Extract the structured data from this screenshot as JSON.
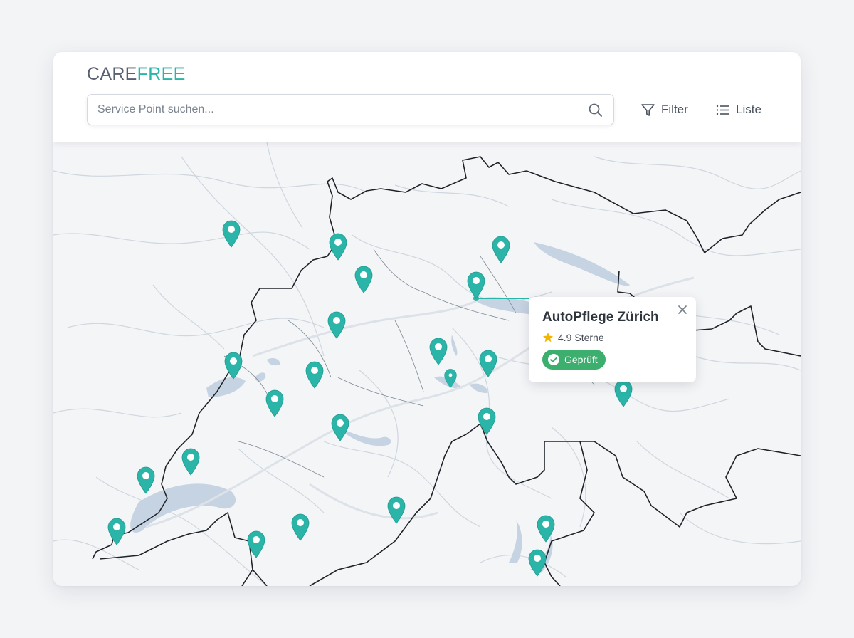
{
  "app": {
    "logo_part1": "CARE",
    "logo_part2": "FREE"
  },
  "search": {
    "placeholder": "Service Point suchen...",
    "value": "",
    "icon": "search-icon"
  },
  "toolbar": {
    "filter_label": "Filter",
    "filter_icon": "filter-icon",
    "list_label": "Liste",
    "list_icon": "list-icon"
  },
  "map": {
    "region": "Switzerland",
    "pin_color": "#2bb5a8",
    "pin_count": 23,
    "selected_pin": "AutoPflege Zürich"
  },
  "popup": {
    "title": "AutoPflege Zürich",
    "rating": "4.9 Sterne",
    "rating_icon": "star-icon",
    "badge": "Geprüft",
    "badge_icon": "check-circle-icon",
    "close_icon": "close-icon"
  },
  "colors": {
    "accent": "#2bb5a8",
    "logo_gray": "#586170",
    "verified_green": "#3cae6d",
    "star_yellow": "#f4b400",
    "water": "#c6d3e2"
  }
}
